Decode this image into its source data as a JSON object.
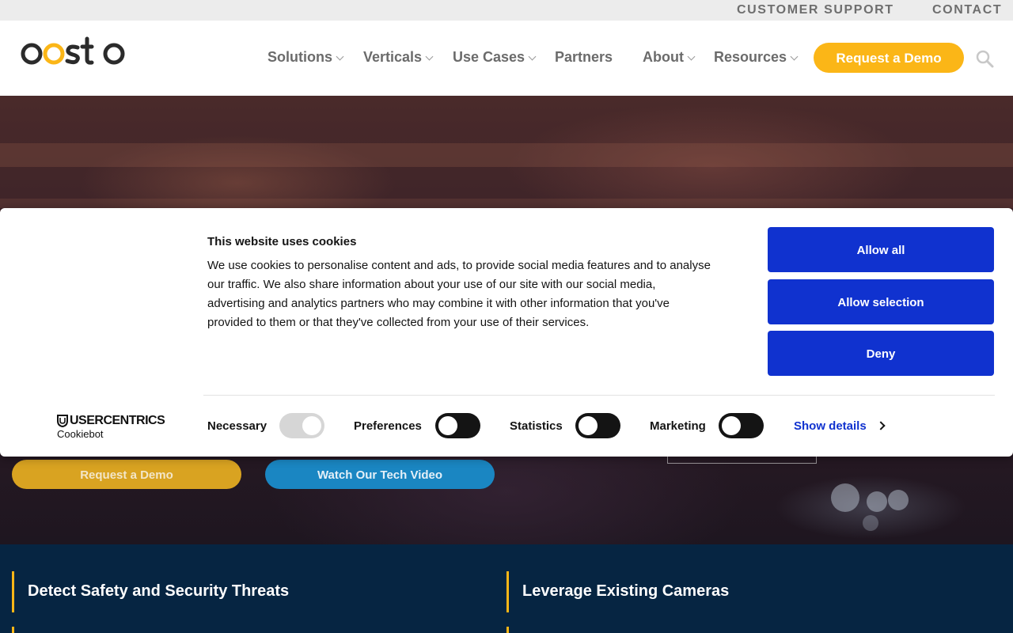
{
  "topbar": {
    "customer_support": "CUSTOMER SUPPORT",
    "contact": "CONTACT"
  },
  "header": {
    "logo_alt": "oosto",
    "nav": [
      {
        "label": "Solutions",
        "has_dropdown": true
      },
      {
        "label": "Verticals",
        "has_dropdown": true
      },
      {
        "label": "Use Cases",
        "has_dropdown": true
      },
      {
        "label": "Partners",
        "has_dropdown": false
      },
      {
        "label": "About",
        "has_dropdown": true
      },
      {
        "label": "Resources",
        "has_dropdown": true
      }
    ],
    "demo_button": "Request a Demo",
    "search_icon": "search-icon"
  },
  "hero": {
    "request_demo": "Request a Demo",
    "watch_video": "Watch Our Tech Video"
  },
  "features": [
    {
      "label": "Detect Safety and Security Threats"
    },
    {
      "label": "Leverage Existing Cameras"
    }
  ],
  "cookie_dialog": {
    "title": "This website uses cookies",
    "body": "We use cookies to personalise content and ads, to provide social media features and to analyse our traffic. We also share information about your use of our site with our social media, advertising and analytics partners who may combine it with other information that you've provided to them or that they've collected from your use of their services.",
    "allow_all": "Allow all",
    "allow_selection": "Allow selection",
    "deny": "Deny",
    "brand": "USERCENTRICS",
    "brand_sub": "Cookiebot",
    "toggles": [
      {
        "label": "Necessary",
        "checked": true,
        "disabled": true
      },
      {
        "label": "Preferences",
        "checked": false
      },
      {
        "label": "Statistics",
        "checked": false
      },
      {
        "label": "Marketing",
        "checked": false
      }
    ],
    "show_details": "Show details"
  },
  "colors": {
    "brand_yellow": "#fbb617",
    "cookie_blue": "#1032cf",
    "navy": "#062542",
    "nav_gray": "#6b6b6b"
  }
}
